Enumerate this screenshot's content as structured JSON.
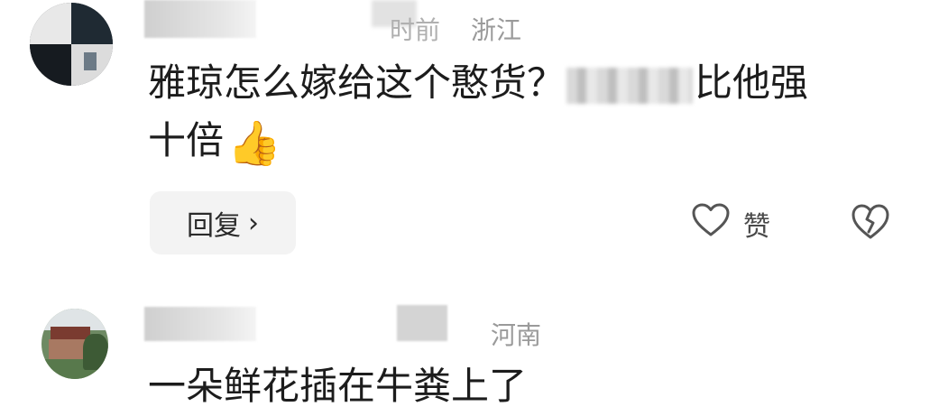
{
  "comments": [
    {
      "time_partial": "时前",
      "region": "浙江",
      "text_line1_start": "雅琼怎么嫁给这个憨货？",
      "text_line1_end": "比他强",
      "text_line2": "十倍",
      "emoji": "👍",
      "reply_label": "回复",
      "reply_chevron": "›",
      "like_label": "赞",
      "icons": {
        "like": "heart-outline-icon",
        "dislike": "broken-heart-icon"
      }
    },
    {
      "region": "河南",
      "text_line1": "一朵鲜花插在牛粪上了"
    }
  ]
}
